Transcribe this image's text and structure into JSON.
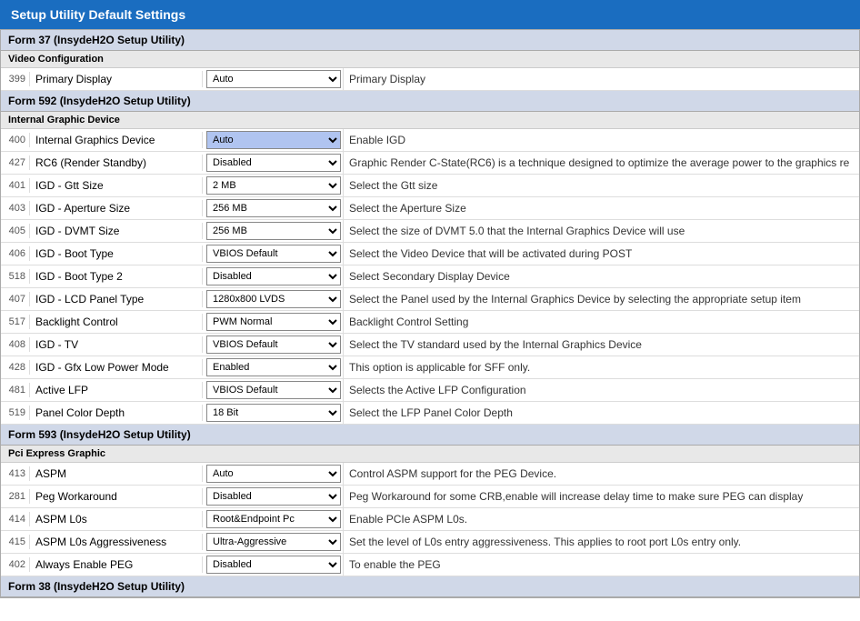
{
  "title": "Setup Utility Default Settings",
  "forms": [
    {
      "id": "form37",
      "label": "Form 37 (InsydeH2O Setup Utility)",
      "sections": [
        {
          "label": "Video Configuration",
          "rows": [
            {
              "id": "399",
              "name": "Primary Display",
              "value": "Auto",
              "desc": "Primary Display",
              "highlighted": false
            }
          ]
        }
      ]
    },
    {
      "id": "form592",
      "label": "Form 592 (InsydeH2O Setup Utility)",
      "sections": [
        {
          "label": "Internal Graphic Device",
          "rows": [
            {
              "id": "400",
              "name": "Internal Graphics Device",
              "value": "Auto",
              "desc": "Enable IGD",
              "highlighted": true
            },
            {
              "id": "427",
              "name": "RC6 (Render Standby)",
              "value": "Disabled",
              "desc": "Graphic Render C-State(RC6) is a technique designed to optimize the average power to the graphics re",
              "highlighted": false
            },
            {
              "id": "401",
              "name": "IGD - Gtt Size",
              "value": "2 MB",
              "desc": "Select the Gtt size",
              "highlighted": false
            },
            {
              "id": "403",
              "name": "IGD - Aperture Size",
              "value": "256 MB",
              "desc": "Select the Aperture Size",
              "highlighted": false
            },
            {
              "id": "405",
              "name": "IGD - DVMT Size",
              "value": "256 MB",
              "desc": "Select the size of DVMT 5.0 that the Internal Graphics Device will use",
              "highlighted": false
            },
            {
              "id": "406",
              "name": "IGD - Boot Type",
              "value": "VBIOS Default",
              "desc": "Select the Video Device that will be activated during POST",
              "highlighted": false
            },
            {
              "id": "518",
              "name": "IGD - Boot Type 2",
              "value": "Disabled",
              "desc": "Select Secondary Display Device",
              "highlighted": false
            },
            {
              "id": "407",
              "name": "IGD - LCD Panel Type",
              "value": "1280x800 LVDS",
              "desc": "Select the Panel used by the Internal Graphics Device by selecting the appropriate setup item",
              "highlighted": false
            },
            {
              "id": "517",
              "name": "Backlight Control",
              "value": "PWM Normal",
              "desc": "Backlight Control Setting",
              "highlighted": false
            },
            {
              "id": "408",
              "name": "IGD - TV",
              "value": "VBIOS Default",
              "desc": "Select the TV standard used by the Internal Graphics Device",
              "highlighted": false
            },
            {
              "id": "428",
              "name": "IGD - Gfx Low Power Mode",
              "value": "Enabled",
              "desc": "This option is applicable for SFF only.",
              "highlighted": false
            },
            {
              "id": "481",
              "name": "Active LFP",
              "value": "VBIOS Default",
              "desc": "Selects the Active LFP Configuration",
              "highlighted": false
            },
            {
              "id": "519",
              "name": "Panel Color Depth",
              "value": "18 Bit",
              "desc": "Select the LFP Panel Color Depth",
              "highlighted": false
            }
          ]
        }
      ]
    },
    {
      "id": "form593",
      "label": "Form 593 (InsydeH2O Setup Utility)",
      "sections": [
        {
          "label": "Pci Express Graphic",
          "rows": [
            {
              "id": "413",
              "name": "ASPM",
              "value": "Auto",
              "desc": "Control ASPM support for the PEG Device.",
              "highlighted": false
            },
            {
              "id": "281",
              "name": "Peg Workaround",
              "value": "Disabled",
              "desc": "Peg Workaround for some CRB,enable will increase delay time to make sure PEG can display",
              "highlighted": false
            },
            {
              "id": "414",
              "name": "ASPM L0s",
              "value": "Root&Endpoint Pc",
              "desc": "Enable PCIe ASPM L0s.",
              "highlighted": false
            },
            {
              "id": "415",
              "name": "ASPM L0s Aggressiveness",
              "value": "Ultra-Aggressive",
              "desc": "Set the level of L0s entry aggressiveness. This applies to root port L0s entry only.",
              "highlighted": false
            },
            {
              "id": "402",
              "name": "Always Enable PEG",
              "value": "Disabled",
              "desc": "To enable the PEG",
              "highlighted": false
            }
          ]
        }
      ]
    },
    {
      "id": "form38",
      "label": "Form 38 (InsydeH2O Setup Utility)",
      "sections": []
    }
  ]
}
